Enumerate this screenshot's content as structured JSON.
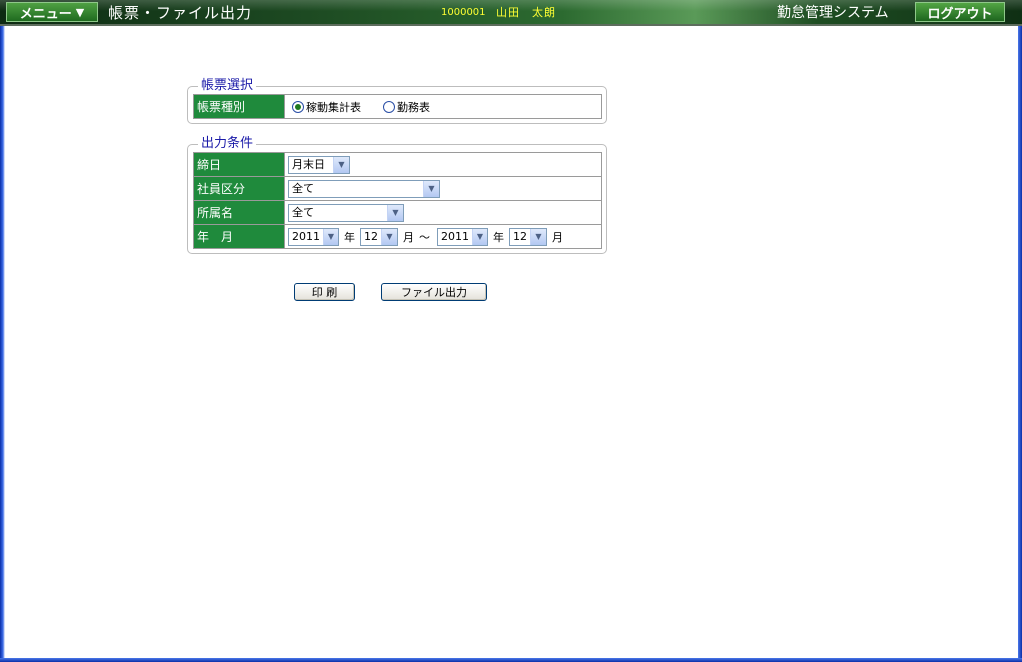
{
  "header": {
    "menu_label": "メニュー",
    "menu_arrow": "▼",
    "page_title": "帳票・ファイル出力",
    "user_id": "1000001",
    "user_name": "山田　太朗",
    "system_name": "勤怠管理システム",
    "logout_label": "ログアウト"
  },
  "report_select": {
    "legend": "帳票選択",
    "type_label": "帳票種別",
    "options": [
      {
        "label": "稼動集計表",
        "selected": true
      },
      {
        "label": "勤務表",
        "selected": false
      }
    ]
  },
  "output_conditions": {
    "legend": "出力条件",
    "closing_day": {
      "label": "締日",
      "value": "月末日"
    },
    "employee_category": {
      "label": "社員区分",
      "value": "全て"
    },
    "department": {
      "label": "所属名",
      "value": "全て"
    },
    "year_month": {
      "label": "年　月",
      "from_year": "2011",
      "from_month": "12",
      "to_year": "2011",
      "to_month": "12",
      "year_unit": "年",
      "month_unit": "月",
      "tilde": "～"
    }
  },
  "actions": {
    "print_label": "印 刷",
    "file_output_label": "ファイル出力"
  },
  "colors": {
    "label_bg": "#1f8a3c",
    "legend_text": "#1a1aa8",
    "header_user_text": "#ffff33"
  }
}
